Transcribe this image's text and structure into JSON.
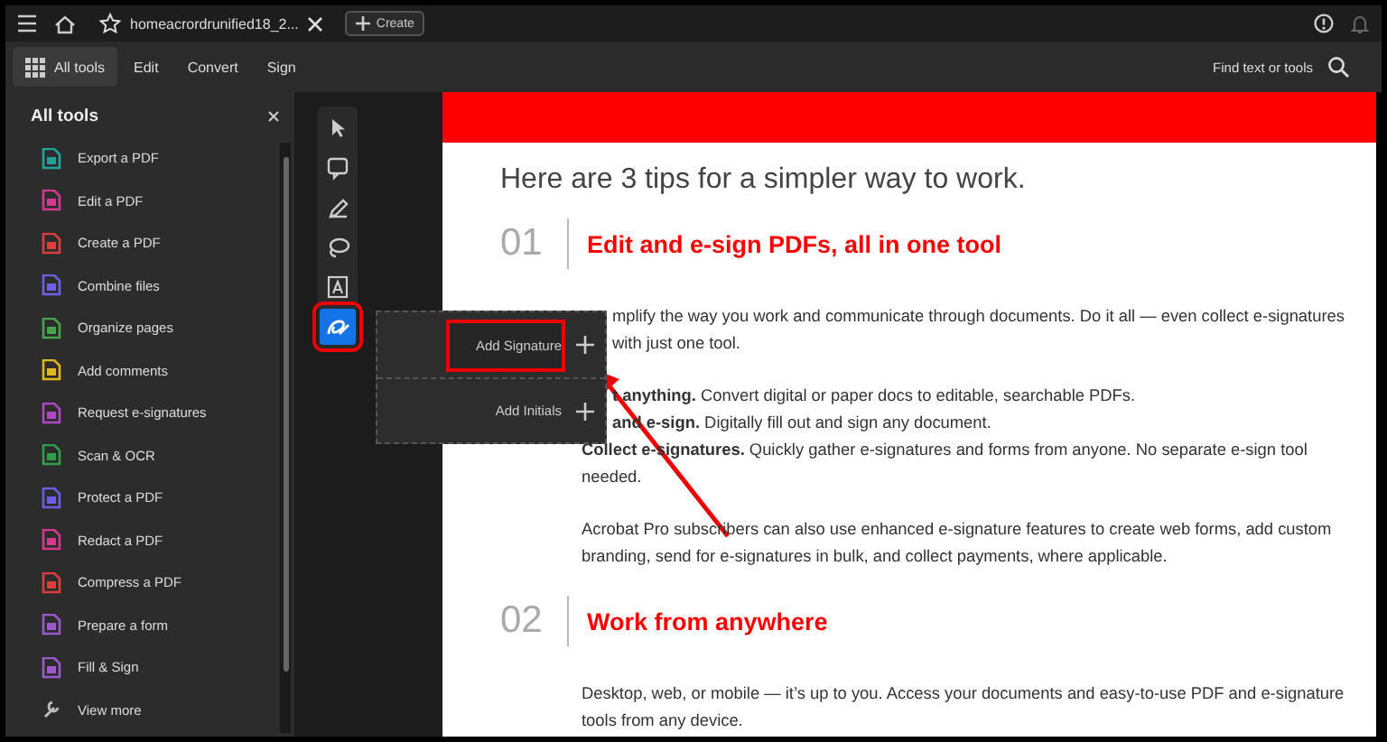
{
  "topbar": {
    "tab_title": "homeacrordrunified18_2...",
    "create": "Create"
  },
  "toolbar": {
    "tabs": [
      {
        "label": "All tools",
        "selected": true
      },
      {
        "label": "Edit",
        "selected": false
      },
      {
        "label": "Convert",
        "selected": false
      },
      {
        "label": "Sign",
        "selected": false
      }
    ],
    "search": "Find text or tools"
  },
  "panel": {
    "title": "All tools",
    "items": [
      {
        "label": "Export a PDF",
        "color": "#1fa39a"
      },
      {
        "label": "Edit a PDF",
        "color": "#d83790"
      },
      {
        "label": "Create a PDF",
        "color": "#e03c3c"
      },
      {
        "label": "Combine files",
        "color": "#6f5fe6"
      },
      {
        "label": "Organize pages",
        "color": "#49a34a"
      },
      {
        "label": "Add comments",
        "color": "#e2b717"
      },
      {
        "label": "Request e-signatures",
        "color": "#b147c8"
      },
      {
        "label": "Scan & OCR",
        "color": "#2e9f4b"
      },
      {
        "label": "Protect a PDF",
        "color": "#6c5ce7"
      },
      {
        "label": "Redact a PDF",
        "color": "#d83790"
      },
      {
        "label": "Compress a PDF",
        "color": "#e03c3c"
      },
      {
        "label": "Prepare a form",
        "color": "#9b59d0"
      },
      {
        "label": "Fill & Sign",
        "color": "#9b59d0"
      }
    ],
    "view_more": "View more"
  },
  "tools": [
    {
      "kind": "select",
      "selected": false,
      "highlighted": false
    },
    {
      "kind": "comment",
      "selected": false,
      "highlighted": false
    },
    {
      "kind": "pen",
      "selected": false,
      "highlighted": false
    },
    {
      "kind": "lasso",
      "selected": false,
      "highlighted": false
    },
    {
      "kind": "textbox",
      "selected": false,
      "highlighted": false
    },
    {
      "kind": "sign",
      "selected": true,
      "highlighted": true
    }
  ],
  "popup": {
    "items": [
      {
        "label": "Add Signature",
        "highlighted": true
      },
      {
        "label": "Add Initials",
        "highlighted": false
      }
    ]
  },
  "document": {
    "heading": "Here are 3 tips for a simpler way to work.",
    "sections": [
      {
        "number": "01",
        "title": "Edit and e-sign PDFs, all in one tool",
        "paragraphs": [
          {
            "text": "mplify the way you work and communicate through documents. Do it all — even collect e-signatures",
            "occluded": true
          },
          {
            "text": "with just one tool.",
            "occluded": true,
            "gap": false
          },
          {
            "text": "**t anything.** Convert digital or paper docs to editable, searchable PDFs.",
            "occluded": true,
            "gap": true
          },
          {
            "text": "**and e-sign.** Digitally fill out and sign any document.",
            "occluded": true,
            "gap": false
          },
          {
            "text": "**Collect e-signatures.** Quickly gather e-signatures and forms from anyone. No separate e-sign tool needed.",
            "occluded": false,
            "gap": false
          },
          {
            "text": "Acrobat Pro subscribers can also use enhanced e-signature features to create web forms, add custom branding, send for e-signatures in bulk, and collect payments, where applicable.",
            "occluded": false,
            "gap": true
          }
        ]
      },
      {
        "number": "02",
        "title": "Work from anywhere",
        "paragraphs": [
          {
            "text": "Desktop, web, or mobile — it’s up to you. Access your documents and easy-to-use PDF and e-signature tools from any device.",
            "occluded": false
          }
        ]
      }
    ]
  }
}
